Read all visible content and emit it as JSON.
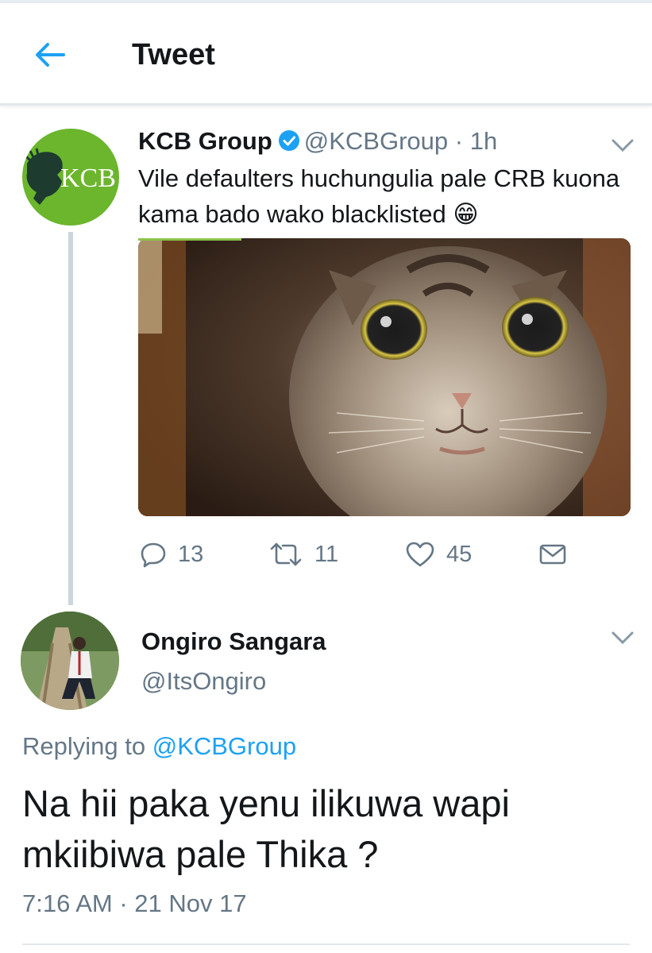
{
  "header": {
    "title": "Tweet"
  },
  "tweet": {
    "author_name": "KCB Group",
    "author_handle": "@KCBGroup",
    "separator": "·",
    "time": "1h",
    "avatar_logo_text": "KCB",
    "text": "Vile defaulters huchungulia pale CRB kuona kama bado wako blacklisted 😁",
    "stats": {
      "replies": "13",
      "retweets": "11",
      "likes": "45"
    }
  },
  "reply": {
    "author_name": "Ongiro Sangara",
    "author_handle": "@ItsOngiro",
    "replying_prefix": "Replying to",
    "replying_to": "@KCBGroup",
    "text": "Na hii paka yenu ilikuwa wapi mkiibiwa pale Thika ?",
    "timestamp": "7:16 AM · 21 Nov 17"
  },
  "colors": {
    "accent": "#1da1f2",
    "muted": "#657786",
    "brand_green": "#6bb62d",
    "verified": "#1da1f2"
  },
  "icons": [
    "back-arrow-icon",
    "verified-badge-icon",
    "chevron-down-icon",
    "reply-icon",
    "retweet-icon",
    "like-icon",
    "share-icon"
  ]
}
